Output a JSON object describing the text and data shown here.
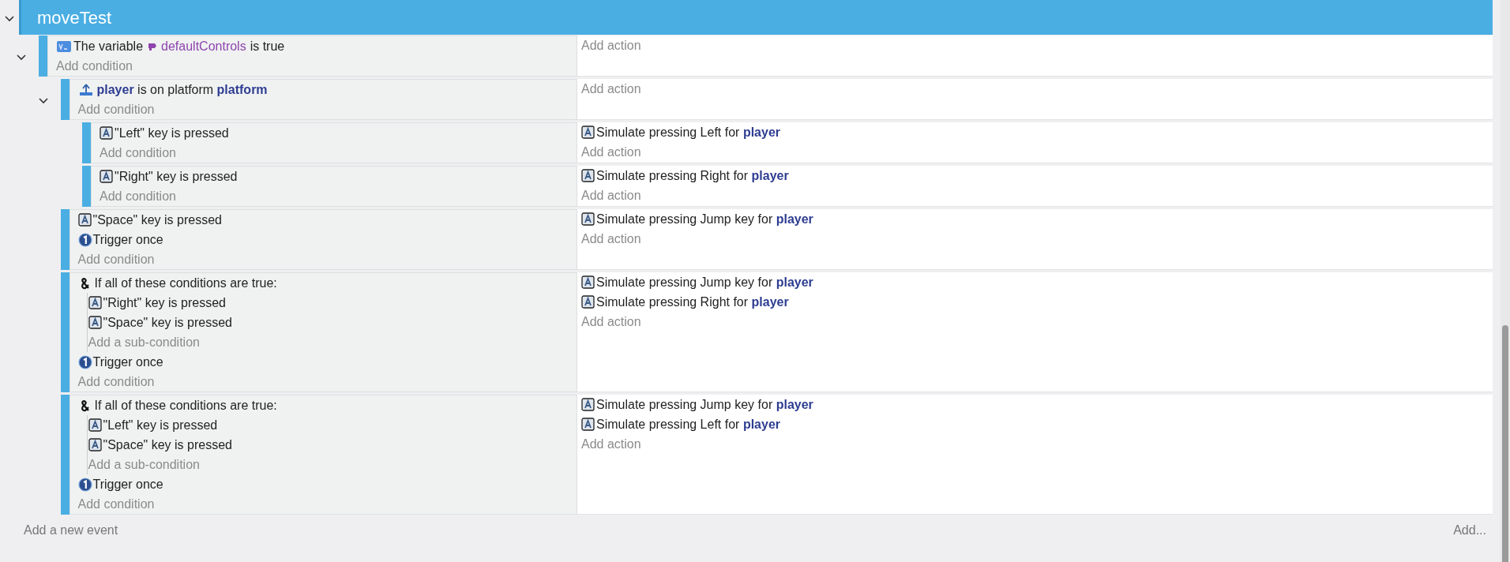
{
  "group": {
    "title": "moveTest",
    "expanded": true
  },
  "events": [
    {
      "expanded": true,
      "conditions": [
        {
          "kind": "variable",
          "text": "The variable",
          "variable": "defaultControls",
          "value_text": "is true"
        }
      ],
      "add_condition": "Add condition",
      "add_action": "Add action",
      "children": [
        {
          "expanded": true,
          "conditions": [
            {
              "kind": "platform",
              "text": "**player** is on platform **platform**"
            }
          ],
          "add_condition": "Add condition",
          "add_action": "Add action",
          "children": [
            {
              "conditions": [
                {
                  "kind": "key",
                  "text": "\"Left\" key is pressed"
                }
              ],
              "add_condition": "Add condition",
              "actions": [
                {
                  "kind": "key",
                  "text": "Simulate pressing Left for **player**"
                }
              ],
              "add_action": "Add action"
            },
            {
              "conditions": [
                {
                  "kind": "key",
                  "text": "\"Right\" key is pressed"
                }
              ],
              "add_condition": "Add condition",
              "actions": [
                {
                  "kind": "key",
                  "text": "Simulate pressing Right for **player**"
                }
              ],
              "add_action": "Add action"
            }
          ]
        },
        {
          "conditions": [
            {
              "kind": "key",
              "text": "\"Space\" key is pressed"
            },
            {
              "kind": "trigger",
              "text": "Trigger once"
            }
          ],
          "add_condition": "Add condition",
          "actions": [
            {
              "kind": "key",
              "text": "Simulate pressing Jump key for **player**"
            }
          ],
          "add_action": "Add action"
        },
        {
          "conditions": [
            {
              "kind": "and",
              "text": "If all of these conditions are true:",
              "sub_conditions": [
                {
                  "kind": "key",
                  "text": "\"Right\" key is pressed"
                },
                {
                  "kind": "key",
                  "text": "\"Space\" key is pressed"
                }
              ],
              "add_sub_condition": "Add a sub-condition"
            },
            {
              "kind": "trigger",
              "text": "Trigger once"
            }
          ],
          "add_condition": "Add condition",
          "actions": [
            {
              "kind": "key",
              "text": "Simulate pressing Jump key for **player**"
            },
            {
              "kind": "key",
              "text": "Simulate pressing Right for **player**"
            }
          ],
          "add_action": "Add action"
        },
        {
          "conditions": [
            {
              "kind": "and",
              "text": "If all of these conditions are true:",
              "sub_conditions": [
                {
                  "kind": "key",
                  "text": "\"Left\" key is pressed"
                },
                {
                  "kind": "key",
                  "text": "\"Space\" key is pressed"
                }
              ],
              "add_sub_condition": "Add a sub-condition"
            },
            {
              "kind": "trigger",
              "text": "Trigger once"
            }
          ],
          "add_condition": "Add condition",
          "actions": [
            {
              "kind": "key",
              "text": "Simulate pressing Jump key for **player**"
            },
            {
              "kind": "key",
              "text": "Simulate pressing Left for **player**"
            }
          ],
          "add_action": "Add action"
        }
      ]
    }
  ],
  "add_event": "Add a new event",
  "add_menu": "Add..."
}
